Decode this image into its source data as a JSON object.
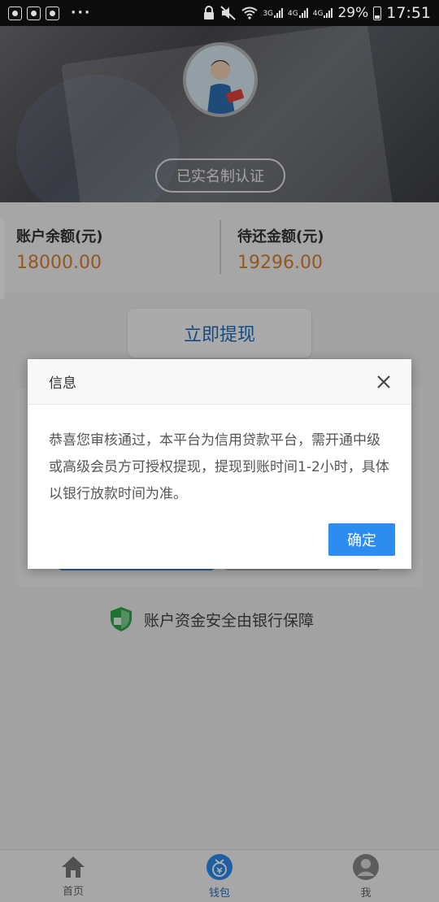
{
  "status_bar": {
    "network_top": "3G",
    "network_mid": "4G",
    "network_stack": "4G",
    "battery": "29%",
    "time": "17:51",
    "overflow": "···"
  },
  "profile": {
    "verified_badge": "已实名制认证"
  },
  "balance": {
    "account_label": "账户余额(元)",
    "account_value": "18000.00",
    "repay_label": "待还金额(元)",
    "repay_value": "19296.00"
  },
  "actions": {
    "withdraw_label": "立即提现"
  },
  "security": {
    "text": "账户资金安全由银行保障"
  },
  "tabs": [
    {
      "label": "首页",
      "icon": "home-icon"
    },
    {
      "label": "钱包",
      "icon": "wallet-icon",
      "active": true
    },
    {
      "label": "我",
      "icon": "user-icon"
    }
  ],
  "dialog": {
    "title": "信息",
    "message": "恭喜您审核通过，本平台为信用贷款平台，需开通中级或高级会员方可授权提现，提现到账时间1-2小时，具体以银行放款时间为准。",
    "confirm_label": "确定"
  },
  "colors": {
    "accent": "#2d8cf0",
    "amount": "#d9822b",
    "shield": "#2eaa4a",
    "link": "#1f6fc0"
  }
}
